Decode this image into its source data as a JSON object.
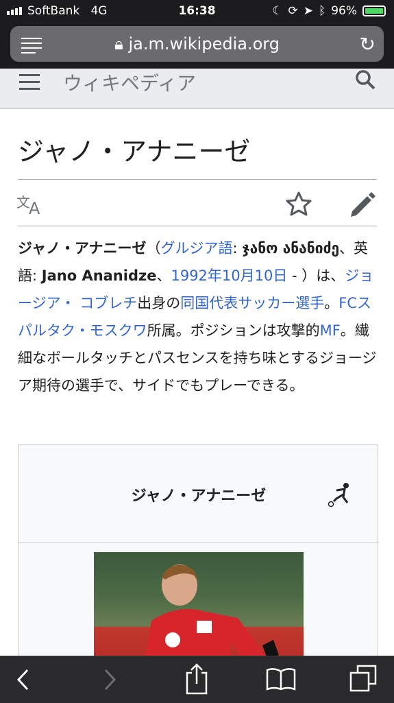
{
  "status": {
    "carrier": "SoftBank",
    "network": "4G",
    "time": "16:38",
    "battery": "96%"
  },
  "browser": {
    "url": "ja.m.wikipedia.org"
  },
  "wiki": {
    "brand": "ウィキペディア"
  },
  "article": {
    "title": "ジャノ・アナニーゼ",
    "lead": {
      "name_bold": "ジャノ・アナニーゼ",
      "p1": "（",
      "link_georgian": "グルジア語",
      "georgian_name": "ჯანო ანანიძე",
      "p2": "、英語: ",
      "english_name": "Jano Ananidze",
      "p3": "、",
      "link_birthdate": "1992年10月10日",
      "p4": " - ）は、",
      "link_place": "ジョージア・ コブレチ",
      "p5": "出身の",
      "link_team": "同国代表サッカー選手",
      "p6": "。",
      "link_club": "FCスパルタク・モスクワ",
      "p7": "所属。ポジションは攻撃的",
      "link_mf": "MF",
      "p8": "。繊細なボールタッチとパスセンスを持ち味とするジョージア期待の選手で、サイドでもプレーできる。"
    },
    "infobox_title": "ジャノ・アナニーゼ"
  },
  "colors": {
    "link": "#3366cc",
    "text": "#202122",
    "accent_battery": "#4cd964"
  }
}
